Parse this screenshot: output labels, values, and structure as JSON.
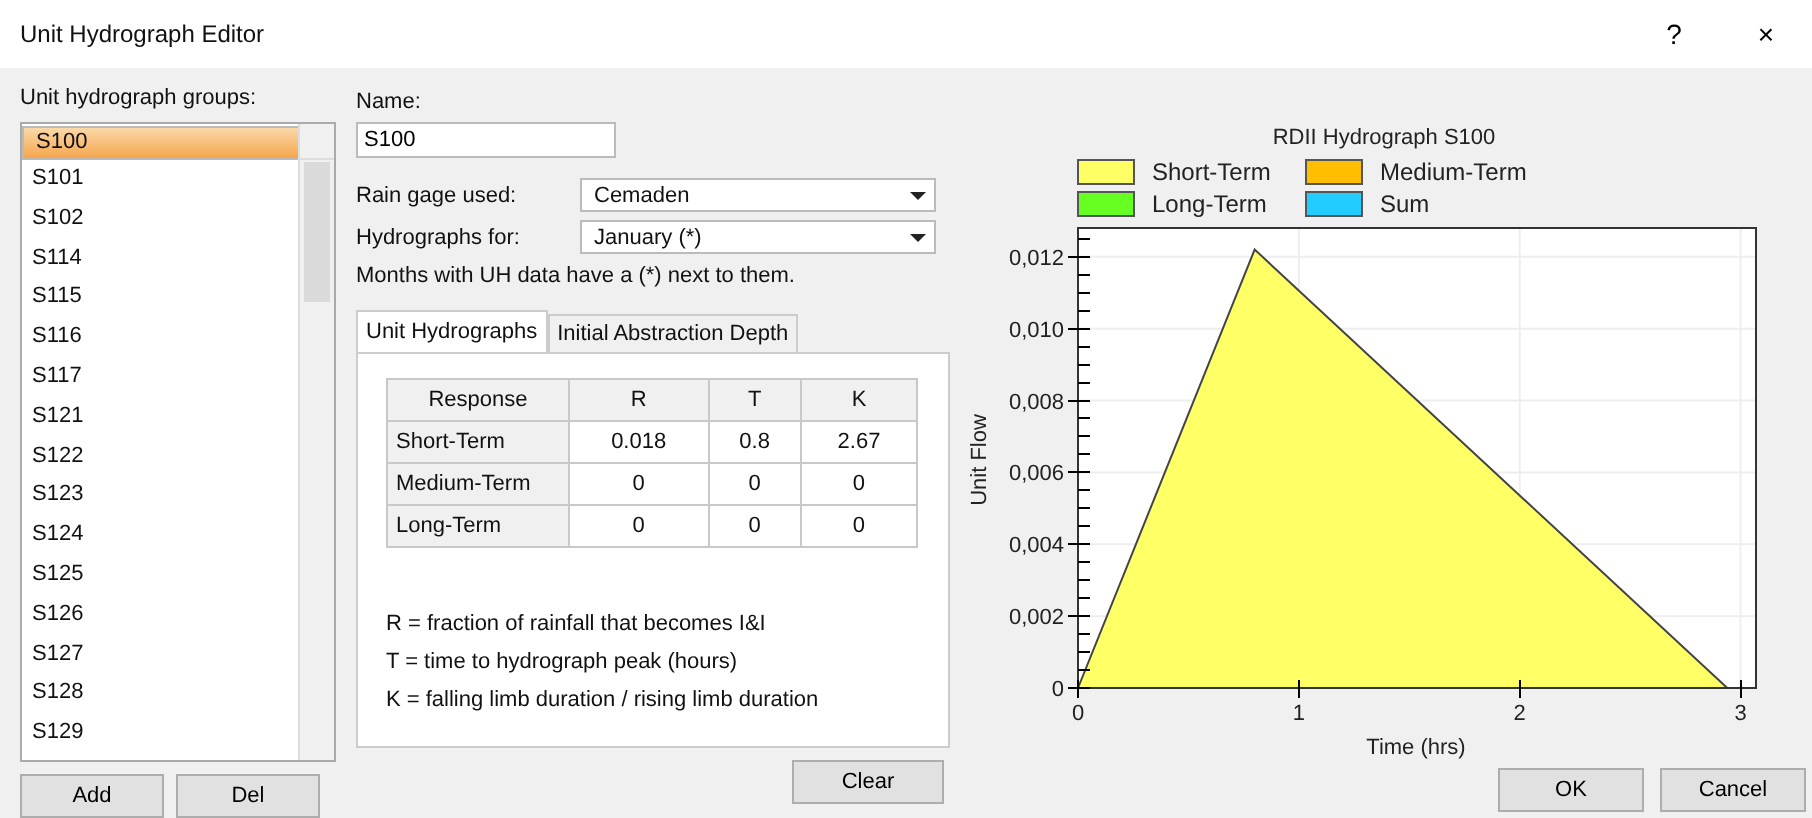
{
  "window": {
    "title": "Unit Hydrograph Editor",
    "help": "?",
    "close": "×"
  },
  "groups": {
    "label": "Unit hydrograph groups:",
    "items": [
      {
        "name": "S100",
        "selected": true
      },
      {
        "name": "S101",
        "selected": false
      },
      {
        "name": "S102",
        "selected": false
      },
      {
        "name": "S114",
        "selected": false
      },
      {
        "name": "S115",
        "selected": false
      },
      {
        "name": "S116",
        "selected": false
      },
      {
        "name": "S117",
        "selected": false
      },
      {
        "name": "S121",
        "selected": false
      },
      {
        "name": "S122",
        "selected": false
      },
      {
        "name": "S123",
        "selected": false
      },
      {
        "name": "S124",
        "selected": false
      },
      {
        "name": "S125",
        "selected": false
      },
      {
        "name": "S126",
        "selected": false
      },
      {
        "name": "S127",
        "selected": false
      },
      {
        "name": "S128",
        "selected": false
      },
      {
        "name": "S129",
        "selected": false
      }
    ],
    "buttons": [
      "Add",
      "Del"
    ]
  },
  "name": {
    "label": "Name:",
    "value": "S100"
  },
  "rain_gage": {
    "label": "Rain gage used:",
    "value": "Cemaden"
  },
  "hydrographs_for": {
    "label": "Hydrographs for:",
    "value": "January (*)"
  },
  "months_note": "Months with UH data have a (*) next to them.",
  "tabs": [
    {
      "label": "Unit Hydrographs",
      "selected": true
    },
    {
      "label": "Initial Abstraction Depth",
      "selected": false
    }
  ],
  "table": {
    "columns": [
      "Response",
      "R",
      "T",
      "K"
    ],
    "rows": [
      [
        "Short-Term",
        "0.018",
        "0.8",
        "2.67"
      ],
      [
        "Medium-Term",
        "0",
        "0",
        "0"
      ],
      [
        "Long-Term",
        "0",
        "0",
        "0"
      ]
    ]
  },
  "notes": [
    "R = fraction of rainfall that becomes I&I",
    "T = time to hydrograph peak (hours)",
    "K = falling limb duration / rising limb duration"
  ],
  "clear_button": "Clear",
  "chart": {
    "chart_data": {
      "type": "area",
      "title": "RDII Hydrograph S100",
      "xlabel": "Time (hrs)",
      "ylabel": "Unit Flow",
      "x": [
        0,
        0.8,
        2.94
      ],
      "grid": true,
      "series": [
        {
          "name": "Short-Term",
          "color": "#ffff66",
          "values": [
            0,
            0.0122,
            0
          ]
        },
        {
          "name": "Medium-Term",
          "color": "#ffbf00",
          "values": [
            null,
            null,
            null
          ]
        },
        {
          "name": "Long-Term",
          "color": "#66ff22",
          "values": [
            null,
            null,
            null
          ]
        },
        {
          "name": "Sum",
          "color": "#22ccff",
          "values": [
            null,
            null,
            null
          ]
        }
      ],
      "xlim": [
        0,
        3.07
      ],
      "ylim": [
        0,
        0.0128
      ],
      "xticks": [
        0,
        1,
        2,
        3
      ],
      "yticks": [
        {
          "value": 0,
          "label": "0"
        },
        {
          "value": 0.002,
          "label": "0,002"
        },
        {
          "value": 0.004,
          "label": "0,004"
        },
        {
          "value": 0.006,
          "label": "0,006"
        },
        {
          "value": 0.008,
          "label": "0,008"
        },
        {
          "value": 0.01,
          "label": "0,010"
        },
        {
          "value": 0.012,
          "label": "0,012"
        }
      ]
    }
  },
  "dialog_buttons": [
    "OK",
    "Cancel"
  ]
}
